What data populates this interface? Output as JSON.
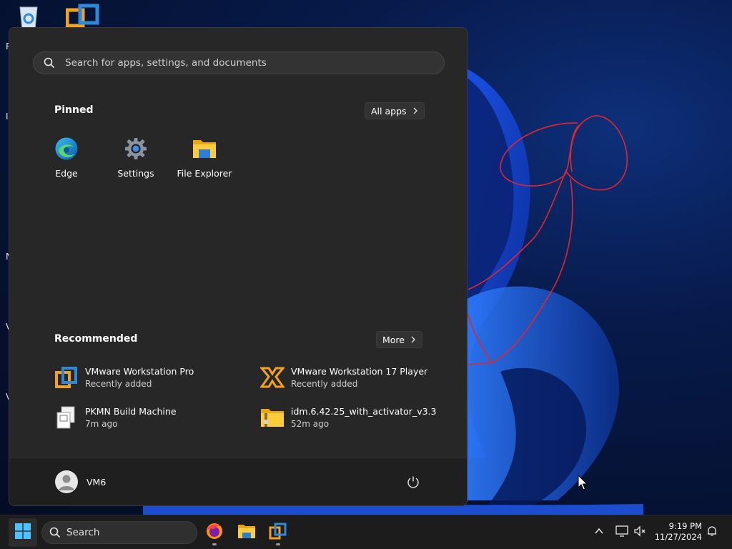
{
  "desktop": {
    "partial_labels": [
      "R",
      "I",
      "N",
      "V",
      "V"
    ]
  },
  "start_menu": {
    "search_placeholder": "Search for apps, settings, and documents",
    "pinned_title": "Pinned",
    "all_apps_label": "All apps",
    "pinned_apps": [
      {
        "label": "Edge",
        "icon": "edge-icon"
      },
      {
        "label": "Settings",
        "icon": "settings-gear-icon"
      },
      {
        "label": "File Explorer",
        "icon": "folder-icon"
      }
    ],
    "recommended_title": "Recommended",
    "more_label": "More",
    "recommended": [
      {
        "name": "VMware Workstation Pro",
        "sub": "Recently added",
        "icon": "vmware-pro-icon"
      },
      {
        "name": "VMware Workstation 17 Player",
        "sub": "Recently added",
        "icon": "vmware-player-icon"
      },
      {
        "name": "PKMN Build Machine",
        "sub": "7m ago",
        "icon": "vm-file-icon"
      },
      {
        "name": "idm.6.42.25_with_activator_v3.3",
        "sub": "52m ago",
        "icon": "zip-folder-icon"
      }
    ],
    "user_name": "VM6"
  },
  "taskbar": {
    "search_label": "Search",
    "time": "9:19 PM",
    "date": "11/27/2024"
  },
  "colors": {
    "menu_bg": "#272727",
    "footer_bg": "#1f1f1f",
    "taskbar_bg": "#1c1c1c",
    "accent": "#0078d4",
    "annotation": "#e0262a"
  }
}
